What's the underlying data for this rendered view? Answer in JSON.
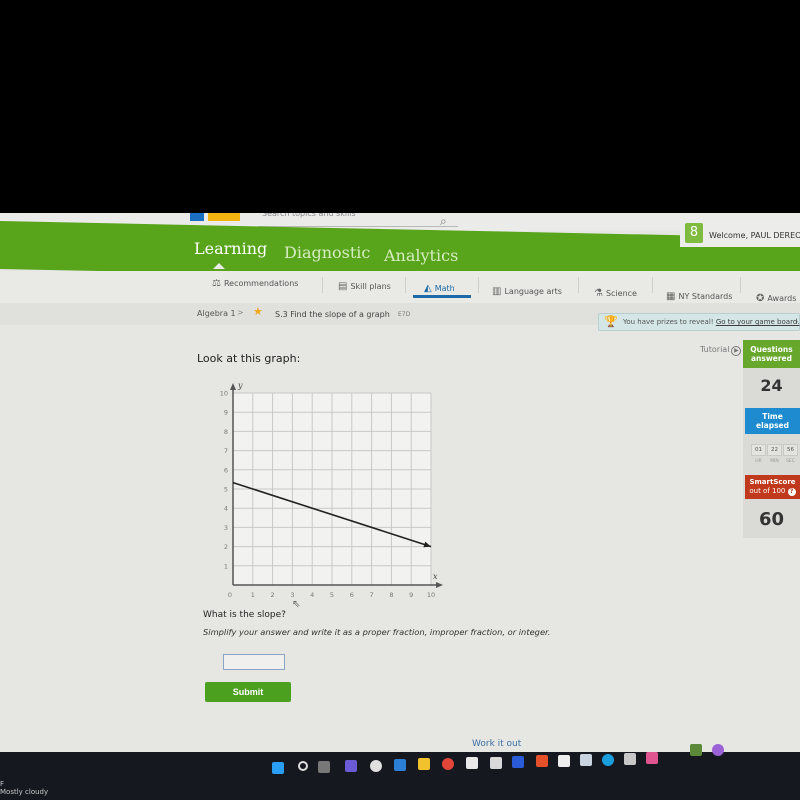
{
  "header": {
    "search_placeholder": "Search topics and skills",
    "tabs": [
      {
        "label": "Learning",
        "active": true
      },
      {
        "label": "Diagnostic",
        "active": false
      },
      {
        "label": "Analytics",
        "active": false
      }
    ],
    "welcome": "Welcome, PAUL DEREON",
    "user_icon": "8"
  },
  "subject_nav": [
    {
      "label": "Recommendations",
      "icon": "recommendations-icon",
      "glyph": "⚖"
    },
    {
      "label": "Skill plans",
      "icon": "skill-plans-icon",
      "glyph": "▤"
    },
    {
      "label": "Math",
      "icon": "math-icon",
      "glyph": "◭",
      "active": true
    },
    {
      "label": "Language arts",
      "icon": "language-arts-icon",
      "glyph": "▥"
    },
    {
      "label": "Science",
      "icon": "science-icon",
      "glyph": "⚗"
    },
    {
      "label": "NY Standards",
      "icon": "standards-icon",
      "glyph": "▦"
    },
    {
      "label": "Awards",
      "icon": "awards-icon",
      "glyph": "✪"
    }
  ],
  "breadcrumb": {
    "course": "Algebra 1",
    "separator": ">",
    "star": "★",
    "skill": "S.3 Find the slope of a graph",
    "code": "E7D"
  },
  "prize_banner": {
    "text": "You have prizes to reveal!",
    "link": "Go to your game board.",
    "close": "›"
  },
  "stats": {
    "tutorial_label": "Tutorial",
    "questions_answered_label": "Questions answered",
    "questions_answered": "24",
    "time_elapsed_label": "Time elapsed",
    "time": {
      "hr": "01",
      "min": "22",
      "sec": "56"
    },
    "time_units": {
      "hr": "HR",
      "min": "MIN",
      "sec": "SEC"
    },
    "smartscore_label": "SmartScore",
    "smartscore_sub": "out of 100",
    "smartscore": "60"
  },
  "question": {
    "intro": "Look at this graph:",
    "prompt": "What is the slope?",
    "instructions": "Simplify your answer and write it as a proper fraction, improper fraction, or integer.",
    "answer_value": "",
    "submit_label": "Submit",
    "work_it_out": "Work it out"
  },
  "chart_data": {
    "type": "line",
    "title": "",
    "xlabel": "x",
    "ylabel": "y",
    "xlim": [
      0,
      10
    ],
    "ylim": [
      0,
      10
    ],
    "xticks": [
      "0",
      "1",
      "2",
      "3",
      "4",
      "5",
      "6",
      "7",
      "8",
      "9",
      "10"
    ],
    "yticks": [
      "1",
      "2",
      "3",
      "4",
      "5",
      "6",
      "7",
      "8",
      "9",
      "10"
    ],
    "grid": true,
    "series": [
      {
        "name": "line",
        "points": [
          [
            0,
            5.333
          ],
          [
            10,
            2
          ]
        ],
        "arrow_end": true
      }
    ]
  },
  "taskbar": {
    "weather": "Mostly cloudy",
    "weather_temp": "F",
    "icons": [
      {
        "name": "windows-start-icon",
        "color": "#2a9df4"
      },
      {
        "name": "search-icon",
        "color": "#dddddd"
      },
      {
        "name": "task-view-icon",
        "color": "#777777"
      },
      {
        "name": "teams-chat-icon",
        "color": "#6b5bd6"
      },
      {
        "name": "app-circle-icon",
        "color": "#e0e0e0"
      },
      {
        "name": "mail-icon",
        "color": "#2b7fd4"
      },
      {
        "name": "file-explorer-icon",
        "color": "#f2c12e"
      },
      {
        "name": "chrome-icon",
        "color": "#e3453a"
      },
      {
        "name": "dropbox-icon",
        "color": "#e8e8e8"
      },
      {
        "name": "store-icon",
        "color": "#d9d9d9"
      },
      {
        "name": "app-v-icon",
        "color": "#2a5bd8"
      },
      {
        "name": "office-icon",
        "color": "#e4502a"
      },
      {
        "name": "document-icon",
        "color": "#eeeeee"
      },
      {
        "name": "photos-icon",
        "color": "#c9d4e0"
      },
      {
        "name": "edge-icon",
        "color": "#1b9ede"
      },
      {
        "name": "roblox-icon",
        "color": "#c8c8c8"
      },
      {
        "name": "instagram-icon",
        "color": "#e0548f"
      },
      {
        "name": "minecraft-icon",
        "color": "#5d8a3a"
      },
      {
        "name": "discord-app-icon",
        "color": "#9a62d6"
      }
    ]
  },
  "colors": {
    "brand_green": "#58a51c",
    "accent_blue": "#1e8bd0",
    "smartscore_red": "#c0391d",
    "submit_green": "#4ca01f"
  }
}
